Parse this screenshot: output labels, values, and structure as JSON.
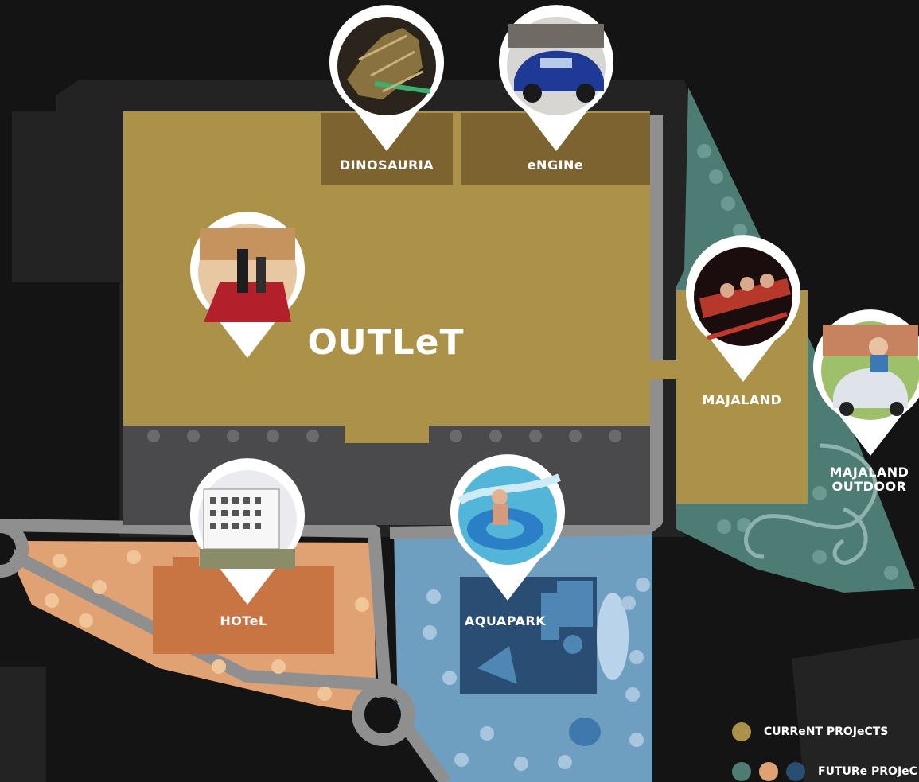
{
  "labels": {
    "outlet": "OUTLeT",
    "dinosauria": "DINOSAURIA",
    "engine": "eNGINe",
    "majaland": "MAJALAND",
    "majaland_outdoor_line1": "MAJALAND",
    "majaland_outdoor_line2": "OUTDOOR",
    "hotel": "HOTeL",
    "aquapark": "AQUAPARK"
  },
  "legend": {
    "current": "CURReNT PROJeCTS",
    "future": "FUTURe PROJeC"
  },
  "colors": {
    "background": "#141414",
    "road_dark": "#232323",
    "road_grey": "#8f8f8f",
    "current": "#ac9148",
    "current_dark": "#7c6330",
    "parking": "#4a4a4c",
    "future_teal": "#4d7c75",
    "future_orange": "#e0a273",
    "future_orange_building": "#c87443",
    "future_blue": "#6e9fc1",
    "future_navy": "#2a4e73",
    "pin_white": "#ffffff"
  },
  "pins": [
    {
      "id": "dinosauria",
      "photo": "dinosaur-skeleton-photo"
    },
    {
      "id": "engine",
      "photo": "blue-classic-car-photo"
    },
    {
      "id": "outlet",
      "photo": "staircase-shoppers-photo"
    },
    {
      "id": "majaland",
      "photo": "rollercoaster-photo"
    },
    {
      "id": "majaland-outdoor",
      "photo": "kid-in-toy-car-photo"
    },
    {
      "id": "hotel",
      "photo": "hotel-building-photo"
    },
    {
      "id": "aquapark",
      "photo": "water-tube-rider-photo"
    }
  ]
}
